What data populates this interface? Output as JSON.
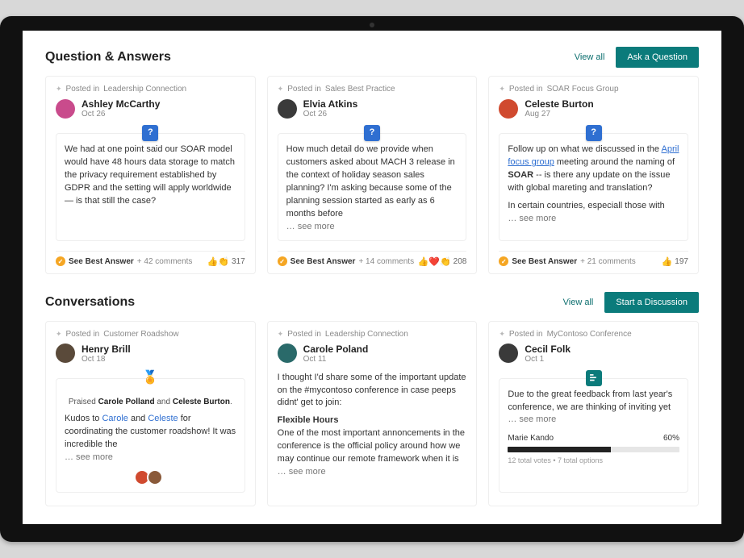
{
  "qa": {
    "title": "Question & Answers",
    "view_all": "View all",
    "cta": "Ask a Question",
    "cards": [
      {
        "posted_prefix": "Posted in",
        "group": "Leadership Connection",
        "author": "Ashley McCarthy",
        "date": "Oct 26",
        "avatar_color": "#c94b8c",
        "body": "We had at one point said our SOAR model would have 48 hours data storage to match the privacy requirement established by GDPR and the setting will apply worldwide — is that still the case?",
        "see_more": "",
        "best_answer_label": "See Best Answer",
        "comments": "+ 42 comments",
        "reactions": "👍👏",
        "reaction_count": "317"
      },
      {
        "posted_prefix": "Posted in",
        "group": "Sales Best Practice",
        "author": "Elvia Atkins",
        "date": "Oct 26",
        "avatar_color": "#3a3a3a",
        "body": "How much detail do we provide when customers asked about MACH 3 release in the context of holiday season sales planning? I'm asking because some of the planning session started as early as 6 months before",
        "see_more": "… see more",
        "best_answer_label": "See Best Answer",
        "comments": "+ 14 comments",
        "reactions": "👍❤️👏",
        "reaction_count": "208"
      },
      {
        "posted_prefix": "Posted in",
        "group": "SOAR Focus Group",
        "author": "Celeste Burton",
        "date": "Aug 27",
        "avatar_color": "#d04a2f",
        "body_pre": "Follow up on what we discussed in the ",
        "body_link": "April focus group",
        "body_mid": " meeting around the naming of ",
        "body_bold": "SOAR",
        "body_post": " -- is there any update on the issue with global mareting and translation?",
        "body_second": "In certain countries, especiall those with",
        "see_more": "… see more",
        "best_answer_label": "See Best Answer",
        "comments": "+ 21 comments",
        "reactions": "👍",
        "reaction_count": "197"
      }
    ]
  },
  "conv": {
    "title": "Conversations",
    "view_all": "View all",
    "cta": "Start a Discussion",
    "cards": [
      {
        "posted_prefix": "Posted in",
        "group": "Customer Roadshow",
        "author": "Henry Brill",
        "date": "Oct 18",
        "avatar_color": "#5a4a3a",
        "type": "praise",
        "praised_prefix": "Praised ",
        "praised_1": "Carole Polland",
        "praised_conj": " and ",
        "praised_2": "Celeste Burton",
        "praised_suffix": ".",
        "body_pre": "Kudos to ",
        "mention_1": "Carole",
        "body_mid": " and ",
        "mention_2": "Celeste",
        "body_post": " for coordinating the customer roadshow! It was incredible the",
        "see_more": "… see more",
        "avatars": [
          "#d04a2f",
          "#8a5a3a"
        ]
      },
      {
        "posted_prefix": "Posted in",
        "group": "Leadership Connection",
        "author": "Carole Poland",
        "date": "Oct 11",
        "avatar_color": "#2a6a6a",
        "type": "post",
        "para1": "I thought I'd share some of the important update on the #mycontoso conference in case peeps didnt' get to join:",
        "heading": "Flexible Hours",
        "para2": "One of the most important annoncements in the conference is the official policy around how we may continue our remote framework when it is",
        "see_more": "… see more"
      },
      {
        "posted_prefix": "Posted in",
        "group": "MyContoso Conference",
        "author": "Cecil Folk",
        "date": "Oct 1",
        "avatar_color": "#3a3a3a",
        "type": "poll",
        "body": "Due to the great feedback from last year's conference, we are thinking of inviting yet",
        "see_more": "… see more",
        "poll_option": "Marie Kando",
        "poll_pct": "60%",
        "poll_fill": 60,
        "poll_meta": "12 total votes  •  7 total options"
      }
    ]
  }
}
